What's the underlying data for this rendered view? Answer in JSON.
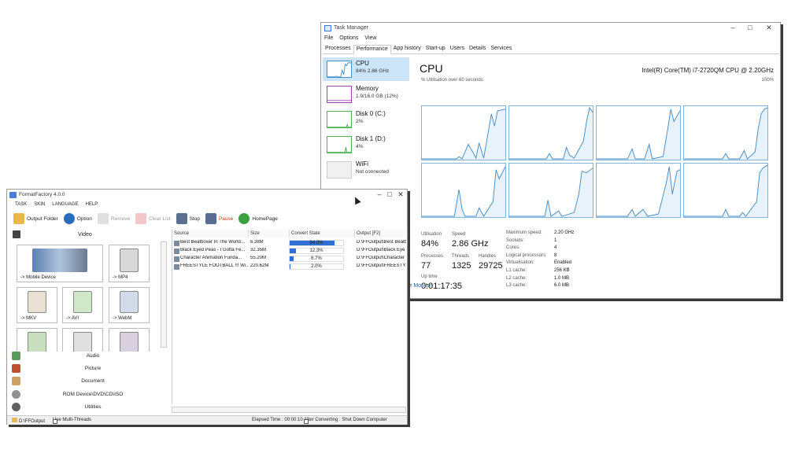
{
  "task_manager": {
    "title": "Task Manager",
    "menu": [
      "File",
      "Options",
      "View"
    ],
    "tabs": [
      "Processes",
      "Performance",
      "App history",
      "Start-up",
      "Users",
      "Details",
      "Services"
    ],
    "active_tab": "Performance",
    "resources": [
      {
        "name": "CPU",
        "detail": "84% 2.86 GHz",
        "color": "#4a90c8"
      },
      {
        "name": "Memory",
        "detail": "1.9/16.0 GB (12%)",
        "color": "#a040b0"
      },
      {
        "name": "Disk 0 (C:)",
        "detail": "2%",
        "color": "#4caf50"
      },
      {
        "name": "Disk 1 (D:)",
        "detail": "4%",
        "color": "#4caf50"
      },
      {
        "name": "WiFi",
        "detail": "Not connected",
        "color": "#9e9e9e"
      }
    ],
    "cpu": {
      "title": "CPU",
      "model": "Intel(R) Core(TM) i7-2720QM CPU @ 2.20GHz",
      "graph_label": "% Utilisation over 60 seconds",
      "graph_max": "100%",
      "utilisation_label": "Utilisation",
      "utilisation": "84%",
      "speed_label": "Speed",
      "speed": "2.86 GHz",
      "processes_label": "Processes",
      "processes": "77",
      "threads_label": "Threads",
      "threads": "1325",
      "handles_label": "Handles",
      "handles": "29725",
      "uptime_label": "Up time",
      "uptime": "0:01:17:35",
      "specs": [
        {
          "k": "Maximum speed:",
          "v": "2.20 GHz"
        },
        {
          "k": "Sockets:",
          "v": "1"
        },
        {
          "k": "Cores:",
          "v": "4"
        },
        {
          "k": "Logical processors:",
          "v": "8"
        },
        {
          "k": "Virtualisation:",
          "v": "Enabled"
        },
        {
          "k": "L1 cache:",
          "v": "256 KB"
        },
        {
          "k": "L2 cache:",
          "v": "1.0 MB"
        },
        {
          "k": "L3 cache:",
          "v": "6.0 MB"
        }
      ]
    },
    "monitor_link": "ce Monitor",
    "accent": "#4a90c8"
  },
  "format_factory": {
    "title": "FormatFactory 4.0.0",
    "menu": [
      "TASK",
      "SKIN",
      "LANGUAGE",
      "HELP"
    ],
    "toolbar": [
      {
        "label": "Output Folder",
        "icon": "folder-icon",
        "enabled": true
      },
      {
        "label": "Option",
        "icon": "option-icon",
        "enabled": true
      },
      {
        "label": "Remove",
        "icon": "remove-icon",
        "enabled": false
      },
      {
        "label": "Clear List",
        "icon": "clear-list-icon",
        "enabled": false
      },
      {
        "label": "Stop",
        "icon": "stop-icon",
        "enabled": true
      },
      {
        "label": "Pause",
        "icon": "pause-icon",
        "enabled": true
      },
      {
        "label": "HomePage",
        "icon": "homepage-icon",
        "enabled": true
      }
    ],
    "section_video": "Video",
    "tiles": [
      {
        "label": "-> Mobile Device",
        "icon": "mobile-device-icon"
      },
      {
        "label": "-> MP4",
        "icon": "mp4-icon"
      },
      {
        "label": "-> MKV",
        "icon": "mkv-icon"
      },
      {
        "label": "-> AVI",
        "icon": "avi-icon"
      },
      {
        "label": "-> WebM",
        "icon": "webm-icon"
      },
      {
        "label": "",
        "icon": "convert-icon"
      },
      {
        "label": "",
        "icon": "gif-icon"
      },
      {
        "label": "",
        "icon": "wmv-icon"
      }
    ],
    "categories": [
      {
        "label": "Audio",
        "icon": "audio-icon"
      },
      {
        "label": "Picture",
        "icon": "picture-icon"
      },
      {
        "label": "Document",
        "icon": "document-icon"
      },
      {
        "label": "ROM Device\\DVD\\CD\\ISO",
        "icon": "rom-device-icon"
      },
      {
        "label": "Utilities",
        "icon": "utilities-icon"
      }
    ],
    "columns": [
      "Source",
      "Size",
      "Convert State",
      "Output [F2]"
    ],
    "rows": [
      {
        "source": "Best Beatboxer In The World...",
        "size": "6.38M",
        "progress": 84.0,
        "state": "84.0%",
        "output": "D:\\FFOutput\\Best Beatb"
      },
      {
        "source": "Black Eyed Peas - I Gotta Fe...",
        "size": "32.35M",
        "progress": 12.3,
        "state": "12.3%",
        "output": "D:\\FFOutput\\Black Eye"
      },
      {
        "source": "Character Animation Funda...",
        "size": "55.20M",
        "progress": 6.7,
        "state": "6.7%",
        "output": "D:\\FFOutput\\Character"
      },
      {
        "source": "FREESTYLE FOOTBALL !!! Wi...",
        "size": "220.62M",
        "progress": 2.0,
        "state": "2.0%",
        "output": "D:\\FFOutput\\FREESTYL"
      }
    ],
    "status": {
      "output_path": "D:\\FFOutput",
      "multi_threads": "Use Multi-Threads",
      "elapsed": "Elapsed Time : 00:00:10",
      "after": "After Converting : Shut Down Computer"
    },
    "progress_color": "#2f6fd3"
  }
}
